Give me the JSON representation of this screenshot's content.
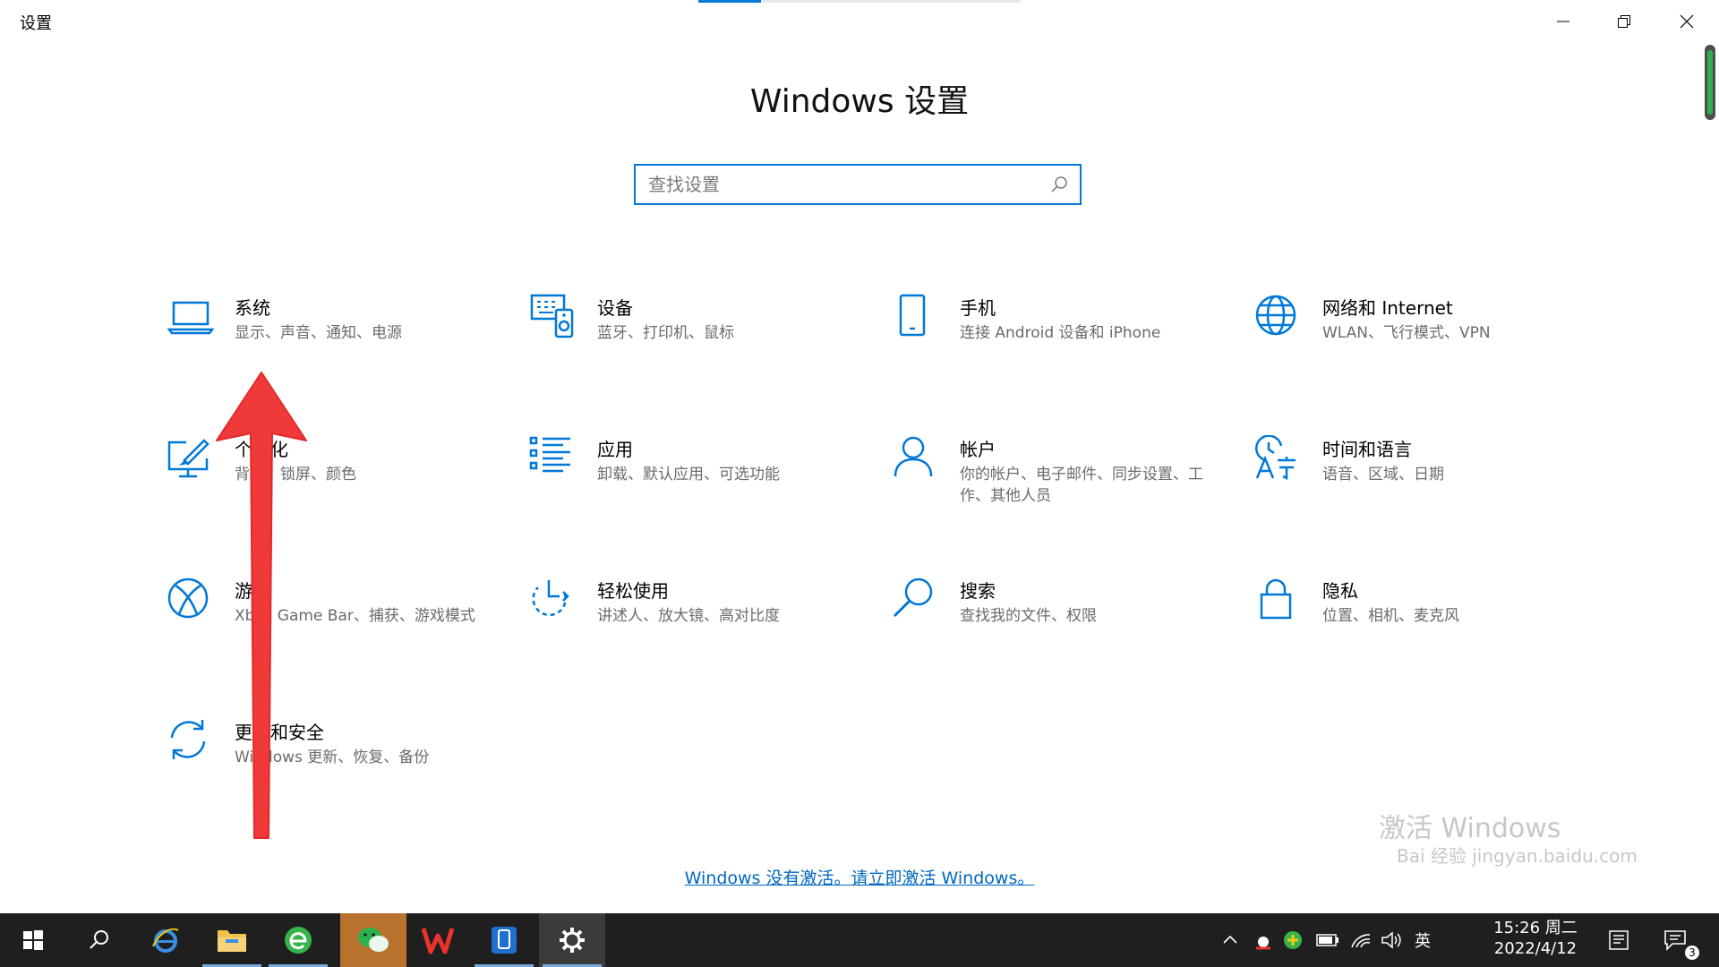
{
  "window": {
    "title": "设置",
    "minimize_icon": "minimize-icon",
    "restore_icon": "restore-icon",
    "close_icon": "close-icon"
  },
  "main": {
    "heading": "Windows 设置",
    "search": {
      "placeholder": "查找设置",
      "value": ""
    },
    "tiles": [
      {
        "title": "系统",
        "desc": "显示、声音、通知、电源",
        "icon": "laptop-icon"
      },
      {
        "title": "设备",
        "desc": "蓝牙、打印机、鼠标",
        "icon": "devices-icon"
      },
      {
        "title": "手机",
        "desc": "连接 Android 设备和 iPhone",
        "icon": "phone-icon"
      },
      {
        "title": "网络和 Internet",
        "desc": "WLAN、飞行模式、VPN",
        "icon": "globe-icon"
      },
      {
        "title": "个性化",
        "desc": "背景、锁屏、颜色",
        "icon": "personalization-icon"
      },
      {
        "title": "应用",
        "desc": "卸载、默认应用、可选功能",
        "icon": "apps-list-icon"
      },
      {
        "title": "帐户",
        "desc": "你的帐户、电子邮件、同步设置、工作、其他人员",
        "icon": "person-icon"
      },
      {
        "title": "时间和语言",
        "desc": "语音、区域、日期",
        "icon": "time-language-icon"
      },
      {
        "title": "游戏",
        "desc": "Xbox Game Bar、捕获、游戏模式",
        "icon": "xbox-icon"
      },
      {
        "title": "轻松使用",
        "desc": "讲述人、放大镜、高对比度",
        "icon": "ease-of-access-icon"
      },
      {
        "title": "搜索",
        "desc": "查找我的文件、权限",
        "icon": "search-magnifier-icon"
      },
      {
        "title": "隐私",
        "desc": "位置、相机、麦克风",
        "icon": "lock-icon"
      },
      {
        "title": "更新和安全",
        "desc": "Windows 更新、恢复、备份",
        "icon": "sync-icon"
      }
    ],
    "activation_link": "Windows 没有激活。请立即激活 Windows。"
  },
  "watermark": {
    "line1": "激活 Windows",
    "line2": "Bai 经验  jingyan.baidu.com"
  },
  "taskbar": {
    "items": [
      "start-icon",
      "search-icon",
      "ie-icon",
      "explorer-icon",
      "browser-icon",
      "wechat-icon",
      "wps-icon",
      "phone-app-icon",
      "settings-gear-icon"
    ],
    "ime": "英",
    "time": "15:26 周二",
    "date": "2022/4/12",
    "notification_count": "3"
  },
  "colors": {
    "accent": "#0078d7",
    "annotation_arrow": "#f03a3a",
    "taskbar": "#1f1f1f"
  }
}
